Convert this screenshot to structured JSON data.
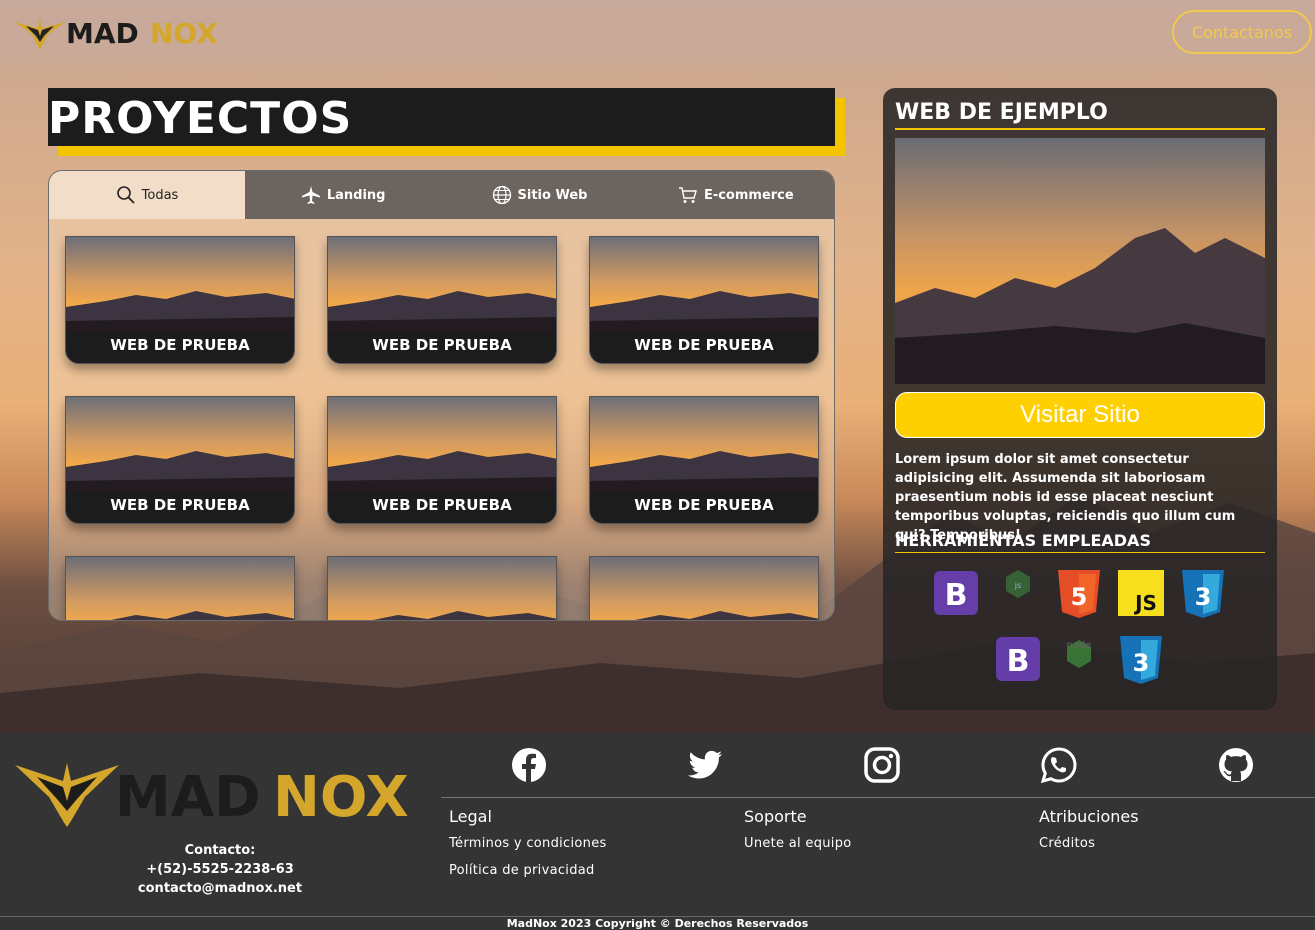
{
  "header": {
    "logo_alt": "MADNOX",
    "contact_button": "Contactanos"
  },
  "projects": {
    "title": "PROYECTOS",
    "tabs": [
      {
        "label": "Todas",
        "icon": "search-icon"
      },
      {
        "label": "Landing",
        "icon": "plane-icon"
      },
      {
        "label": "Sitio Web",
        "icon": "globe-icon"
      },
      {
        "label": "E-commerce",
        "icon": "cart-icon"
      }
    ],
    "cards": [
      "WEB DE PRUEBA",
      "WEB DE PRUEBA",
      "WEB DE PRUEBA",
      "WEB DE PRUEBA",
      "WEB DE PRUEBA",
      "WEB DE PRUEBA",
      "",
      "",
      ""
    ]
  },
  "info": {
    "title": "WEB DE EJEMPLO",
    "visit_button": "Visitar Sitio",
    "description": "Lorem ipsum dolor sit amet consectetur adipisicing elit. Assumenda sit laboriosam praesentium nobis id esse placeat nesciunt temporibus voluptas, reiciendis quo illum cum qui? Temporibus!",
    "tools_title": "HERRAMIENTAS EMPLEADAS",
    "tools": [
      "bootstrap-icon",
      "nodejs-icon",
      "html5-icon",
      "javascript-icon",
      "css3-icon",
      "bootstrap-icon",
      "nodejs-icon",
      "css3-icon"
    ]
  },
  "footer": {
    "logo_alt": "MADNOX",
    "contact_label": "Contacto:",
    "phone": "+(52)-5525-2238-63",
    "email": "contacto@madnox.net",
    "social": [
      "facebook-icon",
      "twitter-icon",
      "instagram-icon",
      "whatsapp-icon",
      "github-icon"
    ],
    "columns": [
      {
        "title": "Legal",
        "links": [
          "Términos y condiciones",
          "Política de privacidad"
        ]
      },
      {
        "title": "Soporte",
        "links": [
          "Unete al equipo"
        ]
      },
      {
        "title": "Atribuciones",
        "links": [
          "Créditos"
        ]
      }
    ],
    "copyright": "MadNox 2023 Copyright © Derechos Reservados"
  },
  "colors": {
    "accent": "#f5c400",
    "dark": "#1c1c1c",
    "footer": "#343434"
  }
}
